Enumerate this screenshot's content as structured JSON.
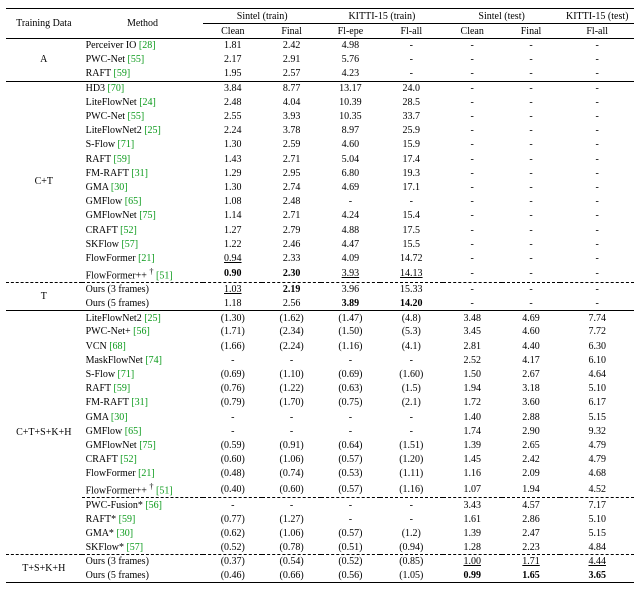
{
  "header": {
    "training_data": "Training Data",
    "method": "Method",
    "sintel_train": "Sintel (train)",
    "kitti_train": "KITTI-15 (train)",
    "sintel_test": "Sintel (test)",
    "kitti_test": "KITTI-15 (test)",
    "clean": "Clean",
    "final": "Final",
    "flepe": "Fl-epe",
    "flall": "Fl-all"
  },
  "chart_data": {
    "type": "table",
    "columns": [
      "Training Data",
      "Method",
      "Sintel(train) Clean",
      "Sintel(train) Final",
      "KITTI-15(train) Fl-epe",
      "KITTI-15(train) Fl-all",
      "Sintel(test) Clean",
      "Sintel(test) Final",
      "KITTI-15(test) Fl-all"
    ],
    "groups": [
      {
        "label": "A",
        "rows": [
          {
            "method": "Perceiver IO",
            "cite": "[28]",
            "v": [
              "1.81",
              "2.42",
              "4.98",
              "-",
              "-",
              "-",
              "-"
            ]
          },
          {
            "method": "PWC-Net",
            "cite": "[55]",
            "v": [
              "2.17",
              "2.91",
              "5.76",
              "-",
              "-",
              "-",
              "-"
            ]
          },
          {
            "method": "RAFT",
            "cite": "[59]",
            "v": [
              "1.95",
              "2.57",
              "4.23",
              "-",
              "-",
              "-",
              "-"
            ]
          }
        ]
      },
      {
        "label": "C+T",
        "rows": [
          {
            "method": "HD3",
            "cite": "[70]",
            "v": [
              "3.84",
              "8.77",
              "13.17",
              "24.0",
              "-",
              "-",
              "-"
            ]
          },
          {
            "method": "LiteFlowNet",
            "cite": "[24]",
            "v": [
              "2.48",
              "4.04",
              "10.39",
              "28.5",
              "-",
              "-",
              "-"
            ]
          },
          {
            "method": "PWC-Net",
            "cite": "[55]",
            "v": [
              "2.55",
              "3.93",
              "10.35",
              "33.7",
              "-",
              "-",
              "-"
            ]
          },
          {
            "method": "LiteFlowNet2",
            "cite": "[25]",
            "v": [
              "2.24",
              "3.78",
              "8.97",
              "25.9",
              "-",
              "-",
              "-"
            ]
          },
          {
            "method": "S-Flow",
            "cite": "[71]",
            "v": [
              "1.30",
              "2.59",
              "4.60",
              "15.9",
              "-",
              "-",
              "-"
            ]
          },
          {
            "method": "RAFT",
            "cite": "[59]",
            "v": [
              "1.43",
              "2.71",
              "5.04",
              "17.4",
              "-",
              "-",
              "-"
            ]
          },
          {
            "method": "FM-RAFT",
            "cite": "[31]",
            "v": [
              "1.29",
              "2.95",
              "6.80",
              "19.3",
              "-",
              "-",
              "-"
            ]
          },
          {
            "method": "GMA",
            "cite": "[30]",
            "v": [
              "1.30",
              "2.74",
              "4.69",
              "17.1",
              "-",
              "-",
              "-"
            ]
          },
          {
            "method": "GMFlow",
            "cite": "[65]",
            "v": [
              "1.08",
              "2.48",
              "-",
              "-",
              "-",
              "-",
              "-"
            ]
          },
          {
            "method": "GMFlowNet",
            "cite": "[75]",
            "v": [
              "1.14",
              "2.71",
              "4.24",
              "15.4",
              "-",
              "-",
              "-"
            ]
          },
          {
            "method": "CRAFT",
            "cite": "[52]",
            "v": [
              "1.27",
              "2.79",
              "4.88",
              "17.5",
              "-",
              "-",
              "-"
            ]
          },
          {
            "method": "SKFlow",
            "cite": "[57]",
            "v": [
              "1.22",
              "2.46",
              "4.47",
              "15.5",
              "-",
              "-",
              "-"
            ]
          },
          {
            "method": "FlowFormer",
            "cite": "[21]",
            "v": [
              "0.94",
              "2.33",
              "4.09",
              "14.72",
              "-",
              "-",
              "-"
            ],
            "ul": [
              0
            ]
          },
          {
            "method": "FlowFormer++",
            "dagger": true,
            "cite": "[51]",
            "v": [
              "0.90",
              "2.30",
              "3.93",
              "14.13",
              "-",
              "-",
              "-"
            ],
            "bold": [
              0,
              1
            ],
            "ul": [
              2,
              3
            ]
          }
        ],
        "dashed_after": 13,
        "ours_group": {
          "label": "T",
          "rows": [
            {
              "method": "Ours (3 frames)",
              "v": [
                "1.03",
                "2.19",
                "3.96",
                "15.33",
                "-",
                "-",
                "-"
              ],
              "bold": [
                1
              ],
              "ul": [
                0
              ]
            },
            {
              "method": "Ours (5 frames)",
              "v": [
                "1.18",
                "2.56",
                "3.89",
                "14.20",
                "-",
                "-",
                "-"
              ],
              "bold": [
                2,
                3
              ]
            }
          ]
        }
      },
      {
        "label": "C+T+S+K+H",
        "rows": [
          {
            "method": "LiteFlowNet2",
            "cite": "[25]",
            "v": [
              "(1.30)",
              "(1.62)",
              "(1.47)",
              "(4.8)",
              "3.48",
              "4.69",
              "7.74"
            ]
          },
          {
            "method": "PWC-Net+",
            "cite": "[56]",
            "v": [
              "(1.71)",
              "(2.34)",
              "(1.50)",
              "(5.3)",
              "3.45",
              "4.60",
              "7.72"
            ]
          },
          {
            "method": "VCN",
            "cite": "[68]",
            "v": [
              "(1.66)",
              "(2.24)",
              "(1.16)",
              "(4.1)",
              "2.81",
              "4.40",
              "6.30"
            ]
          },
          {
            "method": "MaskFlowNet",
            "cite": "[74]",
            "v": [
              "-",
              "-",
              "-",
              "-",
              "2.52",
              "4.17",
              "6.10"
            ]
          },
          {
            "method": "S-Flow",
            "cite": "[71]",
            "v": [
              "(0.69)",
              "(1.10)",
              "(0.69)",
              "(1.60)",
              "1.50",
              "2.67",
              "4.64"
            ]
          },
          {
            "method": "RAFT",
            "cite": "[59]",
            "v": [
              "(0.76)",
              "(1.22)",
              "(0.63)",
              "(1.5)",
              "1.94",
              "3.18",
              "5.10"
            ]
          },
          {
            "method": "FM-RAFT",
            "cite": "[31]",
            "v": [
              "(0.79)",
              "(1.70)",
              "(0.75)",
              "(2.1)",
              "1.72",
              "3.60",
              "6.17"
            ]
          },
          {
            "method": "GMA",
            "cite": "[30]",
            "v": [
              "-",
              "-",
              "-",
              "-",
              "1.40",
              "2.88",
              "5.15"
            ]
          },
          {
            "method": "GMFlow",
            "cite": "[65]",
            "v": [
              "-",
              "-",
              "-",
              "-",
              "1.74",
              "2.90",
              "9.32"
            ]
          },
          {
            "method": "GMFlowNet",
            "cite": "[75]",
            "v": [
              "(0.59)",
              "(0.91)",
              "(0.64)",
              "(1.51)",
              "1.39",
              "2.65",
              "4.79"
            ]
          },
          {
            "method": "CRAFT",
            "cite": "[52]",
            "v": [
              "(0.60)",
              "(1.06)",
              "(0.57)",
              "(1.20)",
              "1.45",
              "2.42",
              "4.79"
            ]
          },
          {
            "method": "FlowFormer",
            "cite": "[21]",
            "v": [
              "(0.48)",
              "(0.74)",
              "(0.53)",
              "(1.11)",
              "1.16",
              "2.09",
              "4.68"
            ]
          },
          {
            "method": "FlowFormer++",
            "dagger": true,
            "cite": "[51]",
            "v": [
              "(0.40)",
              "(0.60)",
              "(0.57)",
              "(1.16)",
              "1.07",
              "1.94",
              "4.52"
            ]
          }
        ],
        "dashed_after": 12,
        "star_rows": [
          {
            "method": "PWC-Fusion*",
            "cite": "[56]",
            "v": [
              "-",
              "-",
              "-",
              "-",
              "3.43",
              "4.57",
              "7.17"
            ]
          },
          {
            "method": "RAFT*",
            "cite": "[59]",
            "v": [
              "(0.77)",
              "(1.27)",
              "-",
              "-",
              "1.61",
              "2.86",
              "5.10"
            ]
          },
          {
            "method": "GMA*",
            "cite": "[30]",
            "v": [
              "(0.62)",
              "(1.06)",
              "(0.57)",
              "(1.2)",
              "1.39",
              "2.47",
              "5.15"
            ]
          },
          {
            "method": "SKFlow*",
            "cite": "[57]",
            "v": [
              "(0.52)",
              "(0.78)",
              "(0.51)",
              "(0.94)",
              "1.28",
              "2.23",
              "4.84"
            ]
          }
        ],
        "ours_group": {
          "label": "T+S+K+H",
          "rows": [
            {
              "method": "Ours (3 frames)",
              "v": [
                "(0.37)",
                "(0.54)",
                "(0.52)",
                "(0.85)",
                "1.00",
                "1.71",
                "4.44"
              ],
              "ul": [
                4,
                5,
                6
              ]
            },
            {
              "method": "Ours (5 frames)",
              "v": [
                "(0.46)",
                "(0.66)",
                "(0.56)",
                "(1.05)",
                "0.99",
                "1.65",
                "3.65"
              ],
              "bold": [
                4,
                5,
                6
              ]
            }
          ]
        }
      }
    ]
  }
}
